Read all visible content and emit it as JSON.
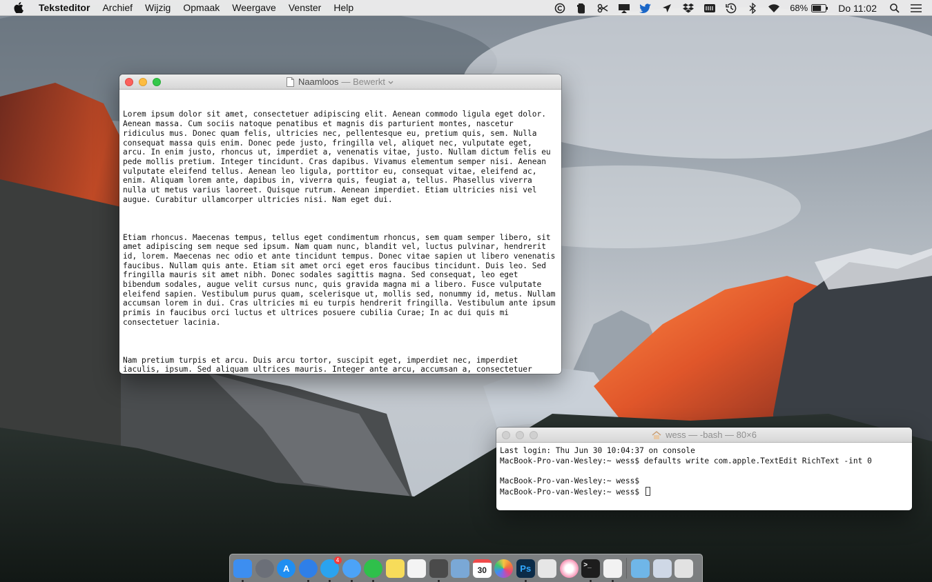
{
  "menubar": {
    "app_name": "Teksteditor",
    "menus": [
      "Archief",
      "Wijzig",
      "Opmaak",
      "Weergave",
      "Venster",
      "Help"
    ],
    "status_icons": [
      "copyright-app-icon",
      "evernote-icon",
      "scissors-icon",
      "airplay-display-icon",
      "twitter-icon",
      "location-arrow-icon",
      "dropbox-icon",
      "memory-chip-icon",
      "time-machine-icon",
      "bluetooth-icon",
      "wifi-icon"
    ],
    "battery_percent": "68%",
    "battery_level": 0.68,
    "clock": "Do 11:02"
  },
  "textedit": {
    "title": "Naamloos",
    "subtitle": "— Bewerkt",
    "paragraphs": [
      "Lorem ipsum dolor sit amet, consectetuer adipiscing elit. Aenean commodo ligula eget dolor. Aenean massa. Cum sociis natoque penatibus et magnis dis parturient montes, nascetur ridiculus mus. Donec quam felis, ultricies nec, pellentesque eu, pretium quis, sem. Nulla consequat massa quis enim. Donec pede justo, fringilla vel, aliquet nec, vulputate eget, arcu. In enim justo, rhoncus ut, imperdiet a, venenatis vitae, justo. Nullam dictum felis eu pede mollis pretium. Integer tincidunt. Cras dapibus. Vivamus elementum semper nisi. Aenean vulputate eleifend tellus. Aenean leo ligula, porttitor eu, consequat vitae, eleifend ac, enim. Aliquam lorem ante, dapibus in, viverra quis, feugiat a, tellus. Phasellus viverra nulla ut metus varius laoreet. Quisque rutrum. Aenean imperdiet. Etiam ultricies nisi vel augue. Curabitur ullamcorper ultricies nisi. Nam eget dui.",
      "Etiam rhoncus. Maecenas tempus, tellus eget condimentum rhoncus, sem quam semper libero, sit amet adipiscing sem neque sed ipsum. Nam quam nunc, blandit vel, luctus pulvinar, hendrerit id, lorem. Maecenas nec odio et ante tincidunt tempus. Donec vitae sapien ut libero venenatis faucibus. Nullam quis ante. Etiam sit amet orci eget eros faucibus tincidunt. Duis leo. Sed fringilla mauris sit amet nibh. Donec sodales sagittis magna. Sed consequat, leo eget bibendum sodales, augue velit cursus nunc, quis gravida magna mi a libero. Fusce vulputate eleifend sapien. Vestibulum purus quam, scelerisque ut, mollis sed, nonummy id, metus. Nullam accumsan lorem in dui. Cras ultricies mi eu turpis hendrerit fringilla. Vestibulum ante ipsum primis in faucibus orci luctus et ultrices posuere cubilia Curae; In ac dui quis mi consectetuer lacinia.",
      "Nam pretium turpis et arcu. Duis arcu tortor, suscipit eget, imperdiet nec, imperdiet iaculis, ipsum. Sed aliquam ultrices mauris. Integer ante arcu, accumsan a, consectetuer eget, posuere ut, mauris. Praesent adipiscing. Phasellus ullamcorper ipsum rutrum nunc. Nunc nonummy metus. Vestibulum volutpat pretium libero. Cras id dui. Aenean ut eros et nisl sagittis vestibulum. Nullam nulla eros, ultricies sit amet, nonummy id, imperdiet feugiat, pede. Sed lectus. Donec mollis hendrerit risus."
    ]
  },
  "terminal": {
    "title": "wess — -bash — 80×6",
    "lines": [
      "Last login: Thu Jun 30 10:04:37 on console",
      "MacBook-Pro-van-Wesley:~ wess$ defaults write com.apple.TextEdit RichText -int 0",
      "",
      "MacBook-Pro-van-Wesley:~ wess$",
      "MacBook-Pro-van-Wesley:~ wess$ "
    ]
  },
  "dock": {
    "apps": [
      {
        "name": "finder-icon",
        "color": "#3d8ef0",
        "label": "",
        "running": true
      },
      {
        "name": "launchpad-icon",
        "color": "#6b6f78",
        "label": "",
        "running": false
      },
      {
        "name": "app-store-icon",
        "color": "#1f8ef1",
        "label": "A",
        "running": false
      },
      {
        "name": "safari-icon",
        "color": "#2f7fe8",
        "label": "",
        "running": true
      },
      {
        "name": "twitter-dock-icon",
        "color": "#2aa3ef",
        "label": "",
        "running": true,
        "badge": "4"
      },
      {
        "name": "messages-icon",
        "color": "#4ca3f7",
        "label": "",
        "running": true
      },
      {
        "name": "whatsapp-icon",
        "color": "#2fc04b",
        "label": "",
        "running": true
      },
      {
        "name": "notes-icon",
        "color": "#f7dc5a",
        "label": "",
        "running": false
      },
      {
        "name": "reminders-icon",
        "color": "#f4f4f4",
        "label": "",
        "running": false
      },
      {
        "name": "evernote-dock-icon",
        "color": "#4a4a4a",
        "label": "",
        "running": true
      },
      {
        "name": "preview-icon",
        "color": "#7aa8d6",
        "label": "",
        "running": false
      },
      {
        "name": "calendar-icon",
        "color": "#ffffff",
        "label": "30",
        "running": false
      },
      {
        "name": "photos-icon",
        "color": "#ffffff",
        "label": "",
        "running": false
      },
      {
        "name": "photoshop-icon",
        "color": "#0b2b47",
        "label": "Ps",
        "running": true
      },
      {
        "name": "keynote-icon",
        "color": "#e6e6e6",
        "label": "",
        "running": false
      },
      {
        "name": "itunes-icon",
        "color": "#f2f2f2",
        "label": "",
        "running": false
      },
      {
        "name": "terminal-icon",
        "color": "#1d1d1d",
        "label": ">_",
        "running": true
      },
      {
        "name": "textedit-icon",
        "color": "#f2f2f2",
        "label": "",
        "running": true
      }
    ],
    "right_items": [
      {
        "name": "downloads-folder-icon",
        "color": "#6fb6e8"
      },
      {
        "name": "recent-apps-stack-icon",
        "color": "#cfd8e6"
      },
      {
        "name": "trash-icon",
        "color": "#e2e2e2"
      }
    ]
  }
}
